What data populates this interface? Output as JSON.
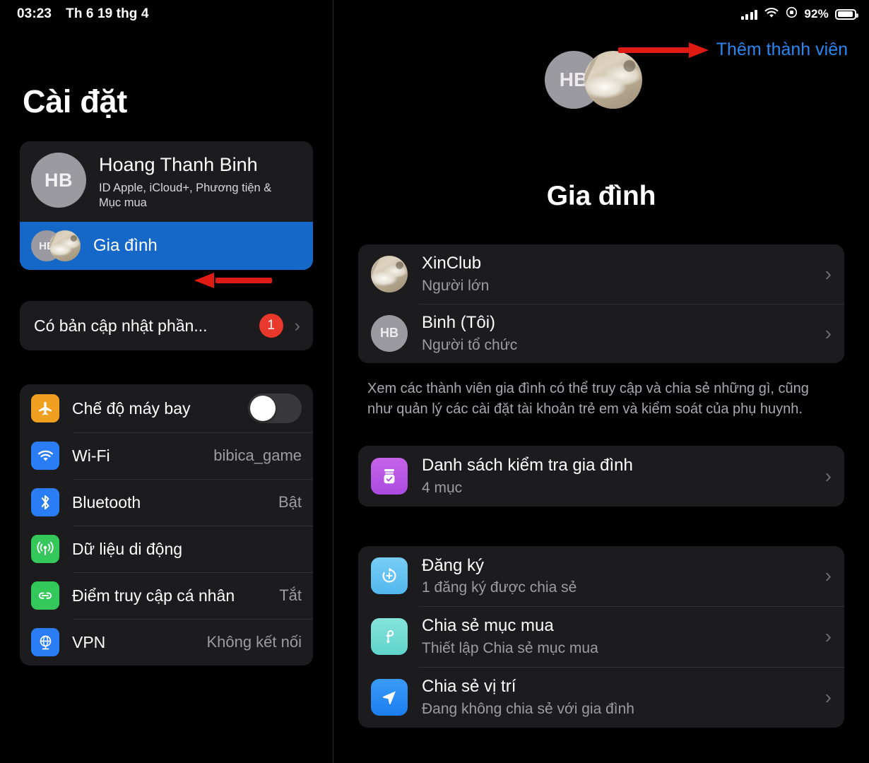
{
  "status_bar": {
    "time": "03:23",
    "date": "Th 6 19 thg 4",
    "battery_percent": "92%",
    "icons": [
      "cellular-signal-icon",
      "wifi-icon",
      "rotation-lock-icon",
      "battery-icon"
    ]
  },
  "sidebar": {
    "title": "Cài đặt",
    "account": {
      "initials": "HB",
      "name": "Hoang Thanh Binh",
      "subtitle": "ID Apple, iCloud+, Phương tiện & Mục mua",
      "family_label": "Gia đình",
      "family_initials": "HB"
    },
    "update": {
      "label": "Có bản cập nhật phần...",
      "badge": "1",
      "chevron": "›"
    },
    "connectivity": [
      {
        "label": "Chế độ máy bay",
        "value": "",
        "icon": "airplane-icon",
        "control": "toggle",
        "toggle_on": false
      },
      {
        "label": "Wi-Fi",
        "value": "bibica_game",
        "icon": "wifi-icon",
        "control": "value"
      },
      {
        "label": "Bluetooth",
        "value": "Bật",
        "icon": "bluetooth-icon",
        "control": "value"
      },
      {
        "label": "Dữ liệu di động",
        "value": "",
        "icon": "cellular-icon",
        "control": "value"
      },
      {
        "label": "Điểm truy cập cá nhân",
        "value": "Tắt",
        "icon": "hotspot-icon",
        "control": "value"
      },
      {
        "label": "VPN",
        "value": "Không kết nối",
        "icon": "vpn-globe-icon",
        "control": "value"
      }
    ]
  },
  "detail": {
    "add_member_label": "Thêm thành viên",
    "hero_title": "Gia đình",
    "hero_initials": "HB",
    "members": [
      {
        "name": "XinClub",
        "role": "Người lớn",
        "avatar": "photo",
        "chevron": "›"
      },
      {
        "name": "Binh (Tôi)",
        "role": "Người tổ chức",
        "avatar": "HB",
        "chevron": "›"
      }
    ],
    "footnote": "Xem các thành viên gia đình có thể truy cập và chia sẻ những gì, cũng như quản lý các cài đặt tài khoản trẻ em và kiểm soát của phụ huynh.",
    "checklist": [
      {
        "title": "Danh sách kiểm tra gia đình",
        "sub": "4 mục",
        "icon": "checklist-icon",
        "chevron": "›"
      }
    ],
    "services": [
      {
        "title": "Đăng ký",
        "sub": "1 đăng ký được chia sẻ",
        "icon": "subscription-icon",
        "chevron": "›"
      },
      {
        "title": "Chia sẻ mục mua",
        "sub": "Thiết lập Chia sẻ mục mua",
        "icon": "purchase-sharing-icon",
        "chevron": "›"
      },
      {
        "title": "Chia sẻ vị trí",
        "sub": "Đang không chia sẻ với gia đình",
        "icon": "location-arrow-icon",
        "chevron": "›"
      }
    ]
  },
  "annotations": {
    "arrow_color": "#e01b14",
    "arrows": [
      "arrow-pointing-to-add-member",
      "arrow-pointing-to-family-row"
    ]
  },
  "colors": {
    "accent_blue": "#2a86f0",
    "selected_row_blue": "#1668c8",
    "badge_red": "#e8392c",
    "card_background": "#1c1c1e",
    "page_background": "#000000"
  }
}
